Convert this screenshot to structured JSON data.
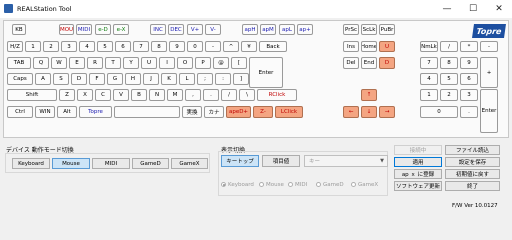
{
  "window": {
    "title": "REALStation Tool",
    "minimize_glyph": "—",
    "maximize_glyph": "☐",
    "close_glyph": "✕"
  },
  "logo_text": "Topre",
  "keys": [
    {
      "id": "kb",
      "label": "KB",
      "color": ""
    },
    {
      "id": "mou",
      "label": "MOU",
      "color": "red"
    },
    {
      "id": "midi",
      "label": "MIDI",
      "color": "blue"
    },
    {
      "id": "e-d",
      "label": "e-D",
      "color": "green"
    },
    {
      "id": "e-x",
      "label": "e-X",
      "color": "green"
    },
    {
      "id": "inc",
      "label": "INC",
      "color": "blue"
    },
    {
      "id": "dec",
      "label": "DEC",
      "color": "blue"
    },
    {
      "id": "v-plus",
      "label": "V+",
      "color": "blue"
    },
    {
      "id": "v-minus",
      "label": "V-",
      "color": "blue"
    },
    {
      "id": "aph",
      "label": "apH",
      "color": "blue"
    },
    {
      "id": "apm",
      "label": "apM",
      "color": "blue"
    },
    {
      "id": "apl",
      "label": "apL",
      "color": "blue"
    },
    {
      "id": "ap-plus",
      "label": "ap+",
      "color": "blue"
    },
    {
      "id": "prsc",
      "label": "PrSc",
      "color": ""
    },
    {
      "id": "sclk",
      "label": "ScLk",
      "color": ""
    },
    {
      "id": "pubr",
      "label": "PuBr",
      "color": ""
    },
    {
      "id": "hz",
      "label": "H/Z",
      "color": ""
    },
    {
      "id": "1",
      "label": "1",
      "color": ""
    },
    {
      "id": "2",
      "label": "2",
      "color": ""
    },
    {
      "id": "3",
      "label": "3",
      "color": ""
    },
    {
      "id": "4",
      "label": "4",
      "color": ""
    },
    {
      "id": "5",
      "label": "5",
      "color": ""
    },
    {
      "id": "6",
      "label": "6",
      "color": ""
    },
    {
      "id": "7",
      "label": "7",
      "color": ""
    },
    {
      "id": "8",
      "label": "8",
      "color": ""
    },
    {
      "id": "9",
      "label": "9",
      "color": ""
    },
    {
      "id": "0",
      "label": "0",
      "color": ""
    },
    {
      "id": "minus",
      "label": "-",
      "color": ""
    },
    {
      "id": "caret",
      "label": "^",
      "color": ""
    },
    {
      "id": "yen",
      "label": "¥",
      "color": ""
    },
    {
      "id": "bksp",
      "label": "Back",
      "color": ""
    },
    {
      "id": "ins",
      "label": "Ins",
      "color": ""
    },
    {
      "id": "home",
      "label": "Home",
      "color": ""
    },
    {
      "id": "pgup",
      "label": "U",
      "color": "orange"
    },
    {
      "id": "numlk",
      "label": "NmLk",
      "color": ""
    },
    {
      "id": "np-slash",
      "label": "/",
      "color": ""
    },
    {
      "id": "np-star",
      "label": "*",
      "color": ""
    },
    {
      "id": "np-minus",
      "label": "-",
      "color": ""
    },
    {
      "id": "tab",
      "label": "TAB",
      "color": ""
    },
    {
      "id": "q",
      "label": "Q",
      "color": ""
    },
    {
      "id": "w",
      "label": "W",
      "color": ""
    },
    {
      "id": "e",
      "label": "E",
      "color": ""
    },
    {
      "id": "r",
      "label": "R",
      "color": ""
    },
    {
      "id": "t",
      "label": "T",
      "color": ""
    },
    {
      "id": "y",
      "label": "Y",
      "color": ""
    },
    {
      "id": "u",
      "label": "U",
      "color": ""
    },
    {
      "id": "i",
      "label": "I",
      "color": ""
    },
    {
      "id": "o",
      "label": "O",
      "color": ""
    },
    {
      "id": "p",
      "label": "P",
      "color": ""
    },
    {
      "id": "at",
      "label": "@",
      "color": ""
    },
    {
      "id": "lbracket",
      "label": "[",
      "color": ""
    },
    {
      "id": "enter",
      "label": "Enter",
      "color": ""
    },
    {
      "id": "del",
      "label": "Del",
      "color": ""
    },
    {
      "id": "end",
      "label": "End",
      "color": ""
    },
    {
      "id": "pgdn",
      "label": "D",
      "color": "orange"
    },
    {
      "id": "np7",
      "label": "7",
      "color": ""
    },
    {
      "id": "np8",
      "label": "8",
      "color": ""
    },
    {
      "id": "np9",
      "label": "9",
      "color": ""
    },
    {
      "id": "np-plus",
      "label": "+",
      "color": ""
    },
    {
      "id": "caps",
      "label": "Caps",
      "color": ""
    },
    {
      "id": "a",
      "label": "A",
      "color": ""
    },
    {
      "id": "s",
      "label": "S",
      "color": ""
    },
    {
      "id": "d",
      "label": "D",
      "color": ""
    },
    {
      "id": "f",
      "label": "F",
      "color": ""
    },
    {
      "id": "g",
      "label": "G",
      "color": ""
    },
    {
      "id": "h",
      "label": "H",
      "color": ""
    },
    {
      "id": "j",
      "label": "J",
      "color": ""
    },
    {
      "id": "k",
      "label": "K",
      "color": ""
    },
    {
      "id": "l",
      "label": "L",
      "color": ""
    },
    {
      "id": "semicolon",
      "label": ";",
      "color": ""
    },
    {
      "id": "colon",
      "label": ":",
      "color": ""
    },
    {
      "id": "rbracket",
      "label": "]",
      "color": ""
    },
    {
      "id": "np4",
      "label": "4",
      "color": ""
    },
    {
      "id": "np5",
      "label": "5",
      "color": ""
    },
    {
      "id": "np6",
      "label": "6",
      "color": ""
    },
    {
      "id": "lshift",
      "label": "Shift",
      "color": ""
    },
    {
      "id": "z",
      "label": "Z",
      "color": ""
    },
    {
      "id": "x",
      "label": "X",
      "color": ""
    },
    {
      "id": "c",
      "label": "C",
      "color": ""
    },
    {
      "id": "v",
      "label": "V",
      "color": ""
    },
    {
      "id": "b",
      "label": "B",
      "color": ""
    },
    {
      "id": "n",
      "label": "N",
      "color": ""
    },
    {
      "id": "m",
      "label": "M",
      "color": ""
    },
    {
      "id": "comma",
      "label": ",",
      "color": ""
    },
    {
      "id": "period",
      "label": ".",
      "color": ""
    },
    {
      "id": "slash",
      "label": "/",
      "color": ""
    },
    {
      "id": "backslash",
      "label": "\\",
      "color": ""
    },
    {
      "id": "rclick",
      "label": "RClick",
      "color": "red"
    },
    {
      "id": "up",
      "label": "↑",
      "color": "orange"
    },
    {
      "id": "np1",
      "label": "1",
      "color": ""
    },
    {
      "id": "np2",
      "label": "2",
      "color": ""
    },
    {
      "id": "np3",
      "label": "3",
      "color": ""
    },
    {
      "id": "np-enter",
      "label": "Enter",
      "color": ""
    },
    {
      "id": "ctrl",
      "label": "Ctrl",
      "color": ""
    },
    {
      "id": "win",
      "label": "WIN",
      "color": ""
    },
    {
      "id": "alt",
      "label": "Alt",
      "color": ""
    },
    {
      "id": "topre",
      "label": "Topre",
      "color": "blue"
    },
    {
      "id": "space",
      "label": "",
      "color": ""
    },
    {
      "id": "henkan",
      "label": "実換",
      "color": ""
    },
    {
      "id": "kana",
      "label": "カナ",
      "color": ""
    },
    {
      "id": "aped",
      "label": "apeD+",
      "color": "orange"
    },
    {
      "id": "z-minus",
      "label": "Z-",
      "color": "orange"
    },
    {
      "id": "lclick",
      "label": "LClick",
      "color": "orange"
    },
    {
      "id": "left",
      "label": "←",
      "color": "orange"
    },
    {
      "id": "down",
      "label": "↓",
      "color": "orange"
    },
    {
      "id": "right",
      "label": "→",
      "color": "orange"
    },
    {
      "id": "np0",
      "label": "0",
      "color": ""
    },
    {
      "id": "np-dot",
      "label": ".",
      "color": ""
    }
  ],
  "device_mode": {
    "label": "デバイス 動作モード切換",
    "options": [
      "Keyboard",
      "Mouse",
      "MIDI",
      "GameD",
      "GameX"
    ],
    "selected": "Mouse"
  },
  "display_switch": {
    "label": "表示切換",
    "options": [
      "キートップ",
      "項目値"
    ],
    "selected": "キートップ",
    "combo_value": "キー"
  },
  "radios": {
    "options": [
      "Keyboard",
      "Mouse",
      "MIDI",
      "GameD",
      "GameX"
    ],
    "selected": "Keyboard"
  },
  "actions": {
    "connecting": "接続中",
    "file_read": "ファイル読込",
    "apply": "適用",
    "save_settings": "設定を保存",
    "ap_register": "ap ｘ に登録",
    "reset_default": "初期値に戻す",
    "firmware_update": "ソフトウェア更新",
    "exit": "終了"
  },
  "version": "F/W Ver 10.0127",
  "colors": {
    "accent_red": "#c00000",
    "accent_blue": "#1a1ab0",
    "accent_green": "#0a7a0a",
    "key_orange": "#f4a582",
    "selected_blue": "#cce4f7",
    "logo_blue": "#1d4fa0"
  }
}
